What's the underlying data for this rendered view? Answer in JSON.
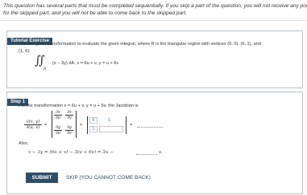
{
  "notice": {
    "line1": "This question has several parts that must be completed sequentially. If you skip a part of the question, you will not receive any poin",
    "line2": "for the skipped part, and you will not be able to come back to the skipped part."
  },
  "tutorial": {
    "header": "Tutorial Exercise",
    "problem_line1": "Use the given transformation to evaluate the given integral, where R is the triangular region with vertices (0, 0), (6, 1), and",
    "problem_line2": "(1, 6).",
    "integrand": "(x − 3y) dA;",
    "region": "R",
    "transform_x": "x = 6u + v,",
    "transform_y": "y = u + 6v"
  },
  "step1": {
    "header": "Step 1",
    "intro": "For the transformation x = 6u + v, y = u + 6v, the Jacobian is",
    "jac_num": "∂(x, y)",
    "jac_den": "∂(u, v)",
    "dx_du_num": "∂x",
    "dx_du_den": "∂u",
    "dx_dv_num": "∂x",
    "dx_dv_den": "∂v",
    "dy_du_num": "∂y",
    "dy_du_den": "∂u",
    "dy_dv_num": "∂y",
    "dy_dv_den": "∂v",
    "eq1": "=",
    "eq2": "=",
    "eq3": "=",
    "m11": "6",
    "m12": "1",
    "m21": "1",
    "m22": "",
    "also": "Also,",
    "expr": "x − 3y = (6u + v) − 3(u + 6v) = 3u −",
    "expr_end": "v."
  },
  "buttons": {
    "submit": "SUBMIT",
    "skip": "SKIP (YOU CANNOT COME BACK)"
  }
}
